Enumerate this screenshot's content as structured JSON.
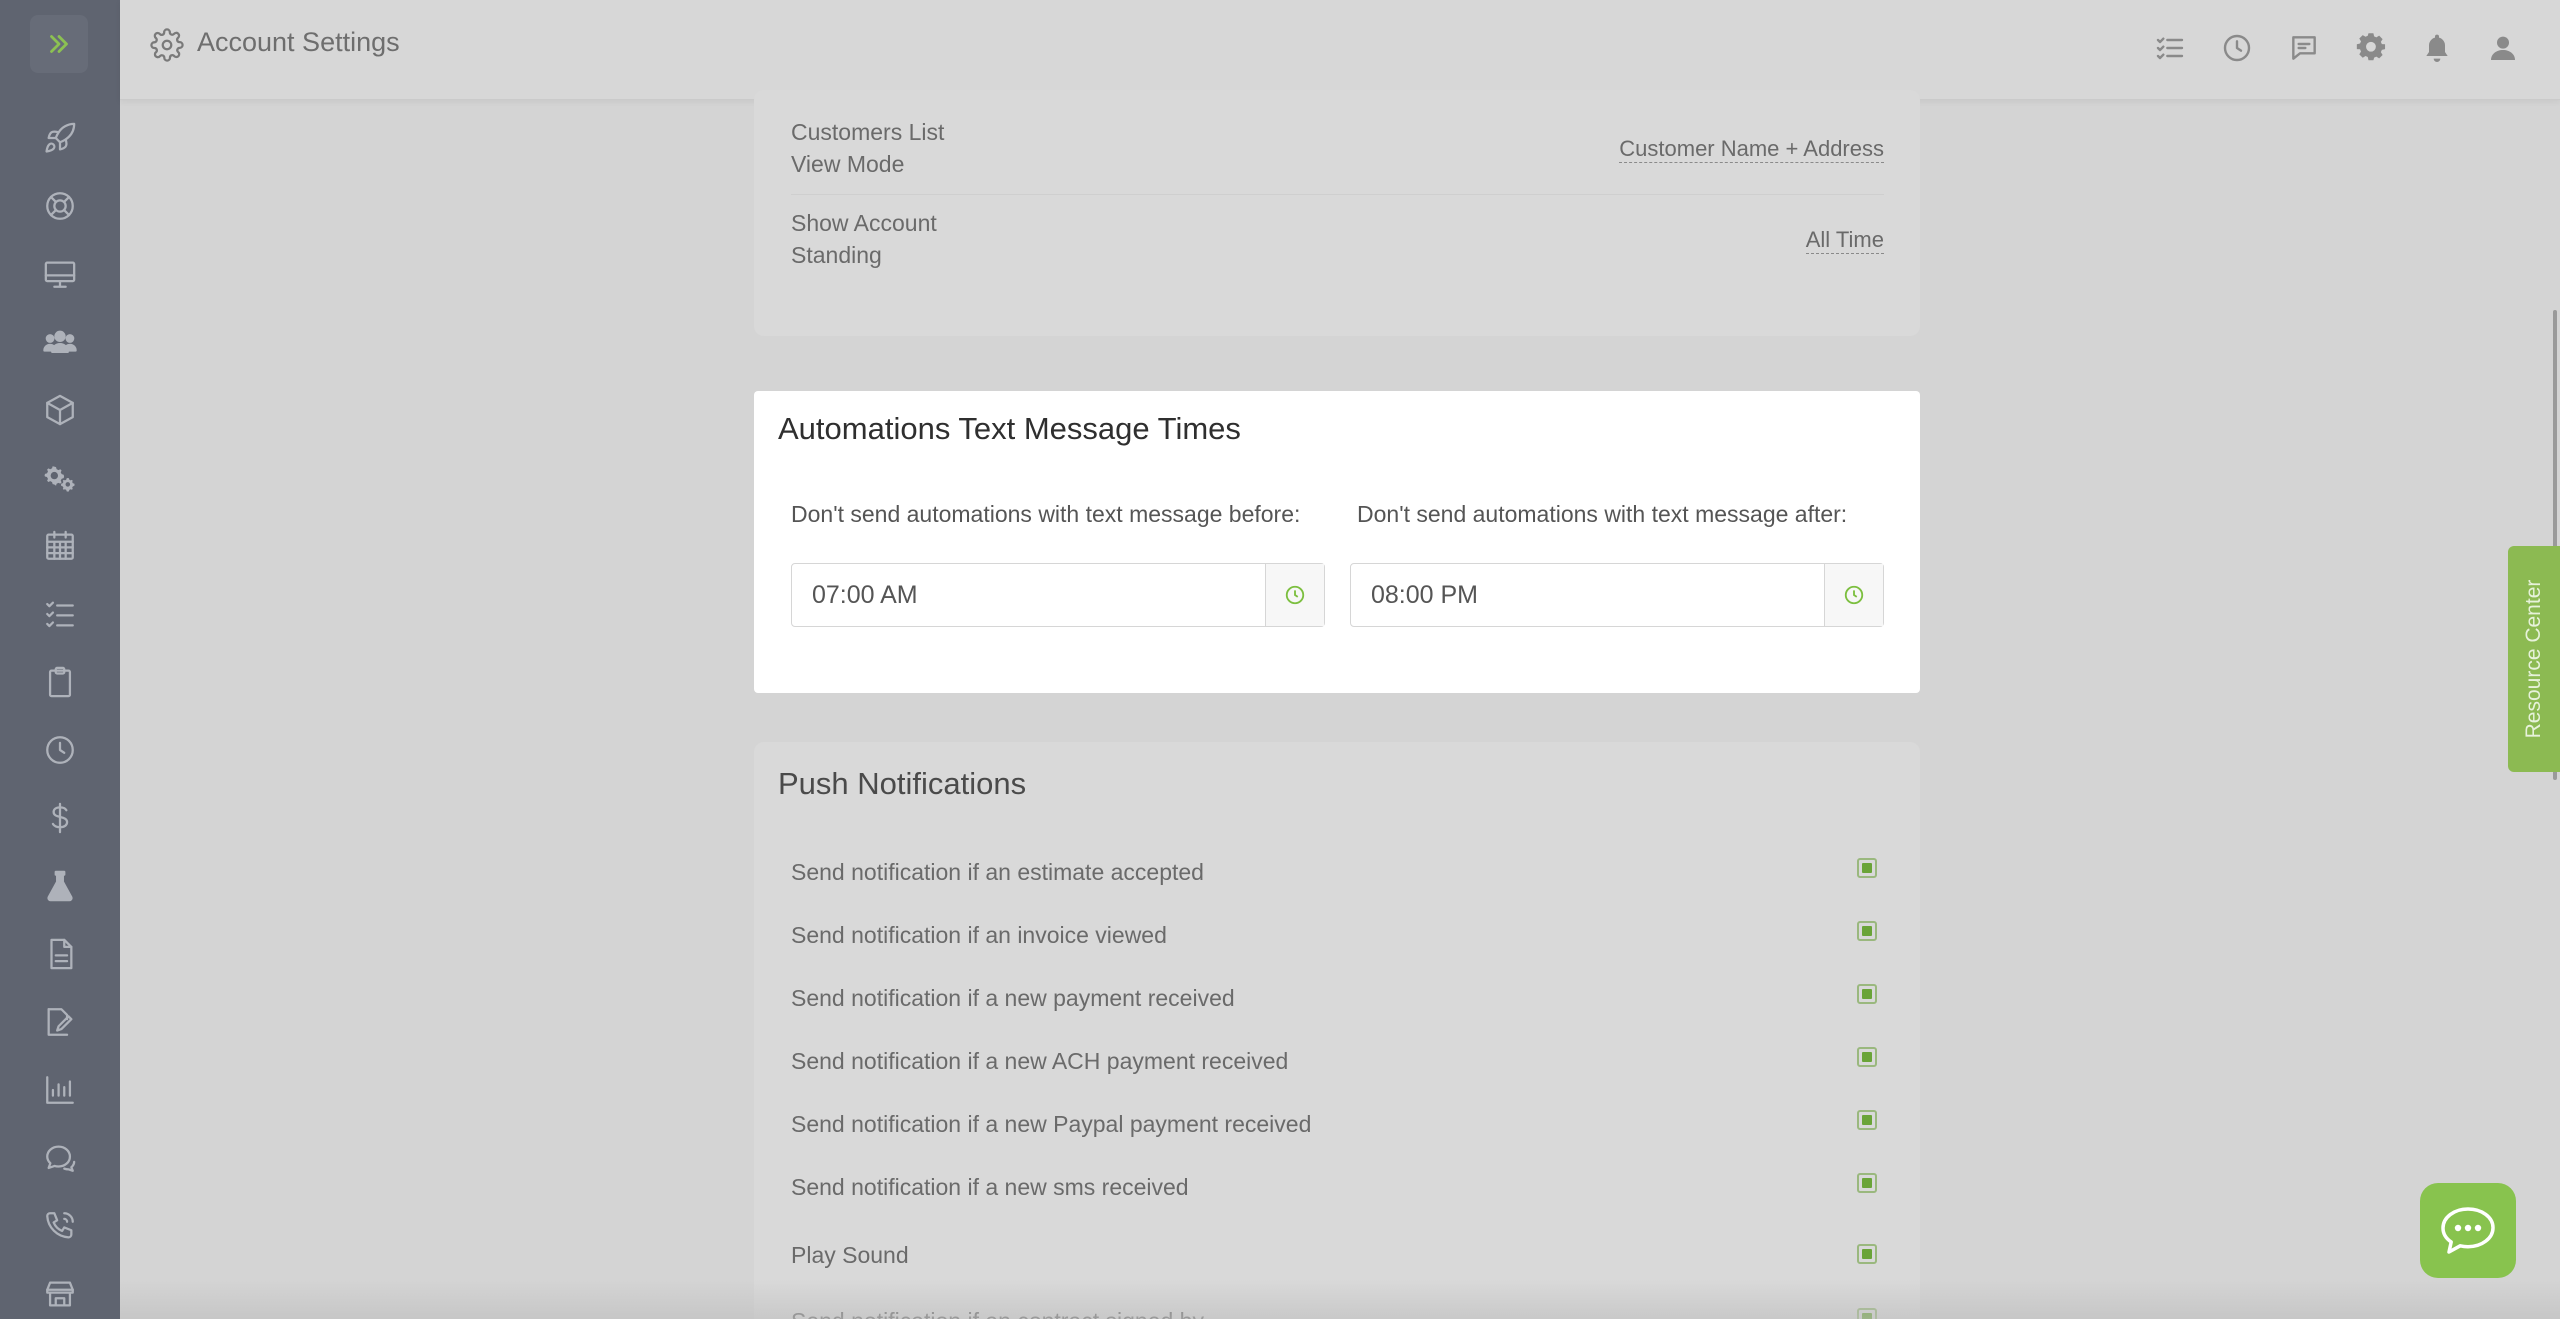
{
  "header": {
    "title": "Account Settings",
    "title_icon": "gear-icon",
    "actions": [
      {
        "name": "tasks-icon"
      },
      {
        "name": "clock-icon"
      },
      {
        "name": "message-icon"
      },
      {
        "name": "settings-icon"
      },
      {
        "name": "bell-icon"
      },
      {
        "name": "user-icon"
      }
    ]
  },
  "sidebar": {
    "toggle_icon": "chevron-double-right-icon",
    "items": [
      {
        "icon": "rocket-icon"
      },
      {
        "icon": "lifebuoy-icon"
      },
      {
        "icon": "monitor-icon"
      },
      {
        "icon": "users-icon"
      },
      {
        "icon": "box-icon"
      },
      {
        "icon": "gears-icon"
      },
      {
        "icon": "calendar-icon"
      },
      {
        "icon": "checklist-icon"
      },
      {
        "icon": "clipboard-icon"
      },
      {
        "icon": "clock-icon"
      },
      {
        "icon": "dollar-icon"
      },
      {
        "icon": "flask-icon"
      },
      {
        "icon": "document-icon"
      },
      {
        "icon": "signature-icon"
      },
      {
        "icon": "chart-icon"
      },
      {
        "icon": "chat-icon"
      },
      {
        "icon": "phone-icon"
      },
      {
        "icon": "store-icon"
      }
    ]
  },
  "prefs": {
    "rows": [
      {
        "label_line1": "Customers List",
        "label_line2": "View Mode",
        "value": "Customer Name + Address"
      },
      {
        "label_line1": "Show Account",
        "label_line2": "Standing",
        "value": "All Time"
      }
    ]
  },
  "automations": {
    "title": "Automations Text Message Times",
    "before_label": "Don't send automations with text message before:",
    "before_value": "07:00 AM",
    "after_label": "Don't send automations with text message after:",
    "after_value": "08:00 PM"
  },
  "push": {
    "title": "Push Notifications",
    "items": [
      {
        "label": "Send notification if an estimate accepted",
        "checked": true
      },
      {
        "label": "Send notification if an invoice viewed",
        "checked": true
      },
      {
        "label": "Send notification if a new payment received",
        "checked": true
      },
      {
        "label": "Send notification if a new ACH payment received",
        "checked": true
      },
      {
        "label": "Send notification if a new Paypal payment received",
        "checked": true
      },
      {
        "label": "Send notification if a new sms received",
        "checked": true
      },
      {
        "label": "Play Sound",
        "checked": true
      },
      {
        "label": "Send notification if an contract signed by ...",
        "checked": true
      }
    ]
  },
  "resource_center": {
    "label": "Resource Center"
  },
  "chat": {
    "icon": "chat-bubble-icon"
  },
  "colors": {
    "accent": "#7cbf3f",
    "sidebar": "#5f6470",
    "overlay": "#d4d4d4"
  }
}
